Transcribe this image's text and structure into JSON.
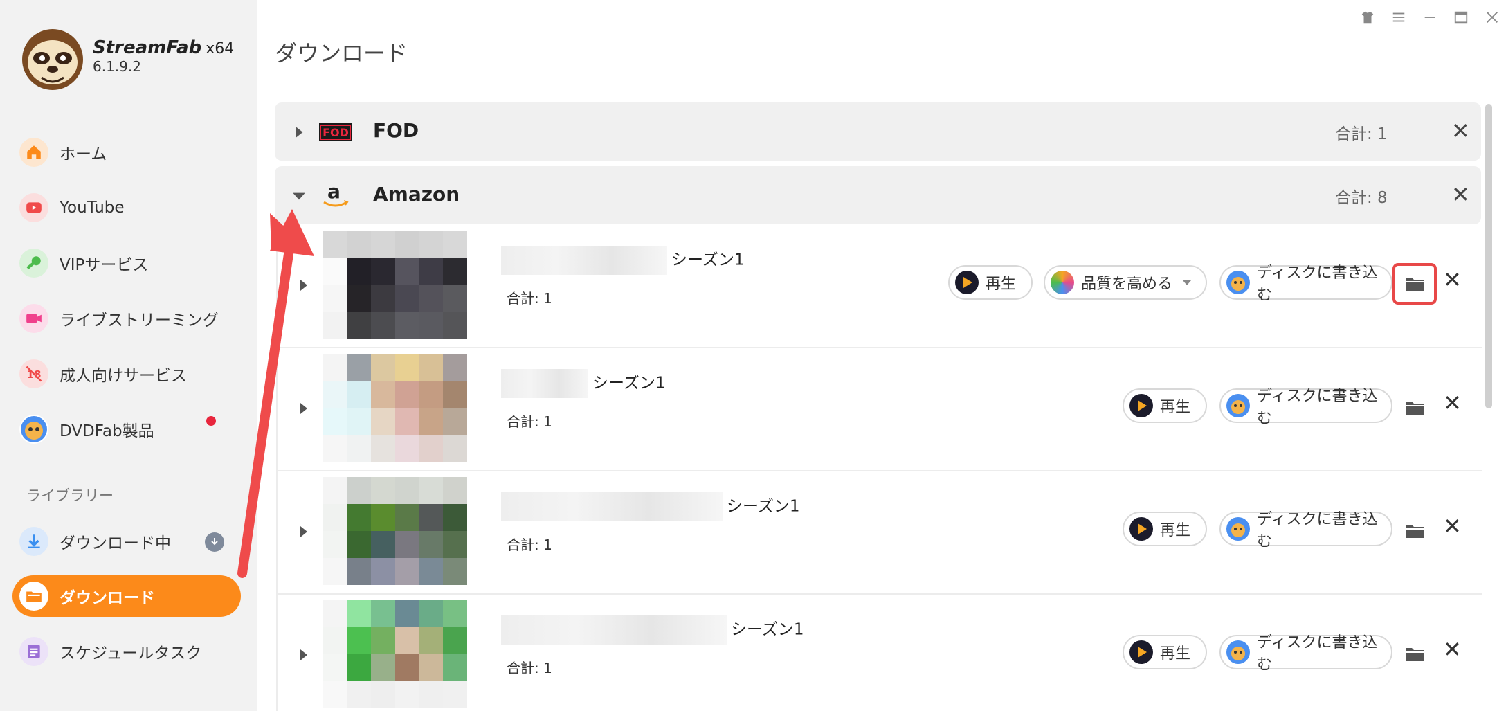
{
  "app": {
    "name": "StreamFab",
    "arch": "x64",
    "version": "6.1.9.2"
  },
  "sidebar": {
    "items": [
      {
        "label": "ホーム",
        "icon": "home-icon",
        "color": "#fc8a1a"
      },
      {
        "label": "YouTube",
        "icon": "youtube-icon",
        "color": "#f04a4a"
      },
      {
        "label": "VIPサービス",
        "icon": "key-icon",
        "color": "#4cbc4c"
      },
      {
        "label": "ライブストリーミング",
        "icon": "video-camera-icon",
        "color": "#f0408c"
      },
      {
        "label": "成人向けサービス",
        "icon": "adult-18-icon",
        "color": "#f04a4a"
      },
      {
        "label": "DVDFab製品",
        "icon": "dvdfab-icon",
        "color": "#4a8ff0"
      }
    ],
    "library_label": "ライブラリー",
    "library_items": [
      {
        "label": "ダウンロード中",
        "icon": "download-arrow-icon",
        "color": "#3a8ff0"
      },
      {
        "label": "ダウンロード",
        "icon": "folder-icon",
        "color": "#fc8a1a",
        "active": true
      },
      {
        "label": "スケジュールタスク",
        "icon": "schedule-list-icon",
        "color": "#9b6fd6"
      }
    ]
  },
  "main": {
    "title": "ダウンロード",
    "groups": [
      {
        "name": "FOD",
        "logo": "FOD",
        "total": "合計: 1",
        "expanded": false
      },
      {
        "name": "Amazon",
        "logo": "a",
        "total": "合計: 8",
        "expanded": true
      }
    ],
    "rows": [
      {
        "title": "シーズン1",
        "total": "合計: 1",
        "has_enhance": true
      },
      {
        "title": "シーズン1",
        "total": "合計: 1",
        "has_enhance": false
      },
      {
        "title": "シーズン1",
        "total": "合計: 1",
        "has_enhance": false
      },
      {
        "title": "シーズン1",
        "total": "合計: 1",
        "has_enhance": false
      }
    ],
    "buttons": {
      "play": "再生",
      "enhance": "品質を高める",
      "burn": "ディスクに書き込む"
    }
  },
  "colors": {
    "accent": "#fc8a1a",
    "highlight": "#e84848",
    "annotation_arrow": "#ef4b4b"
  }
}
